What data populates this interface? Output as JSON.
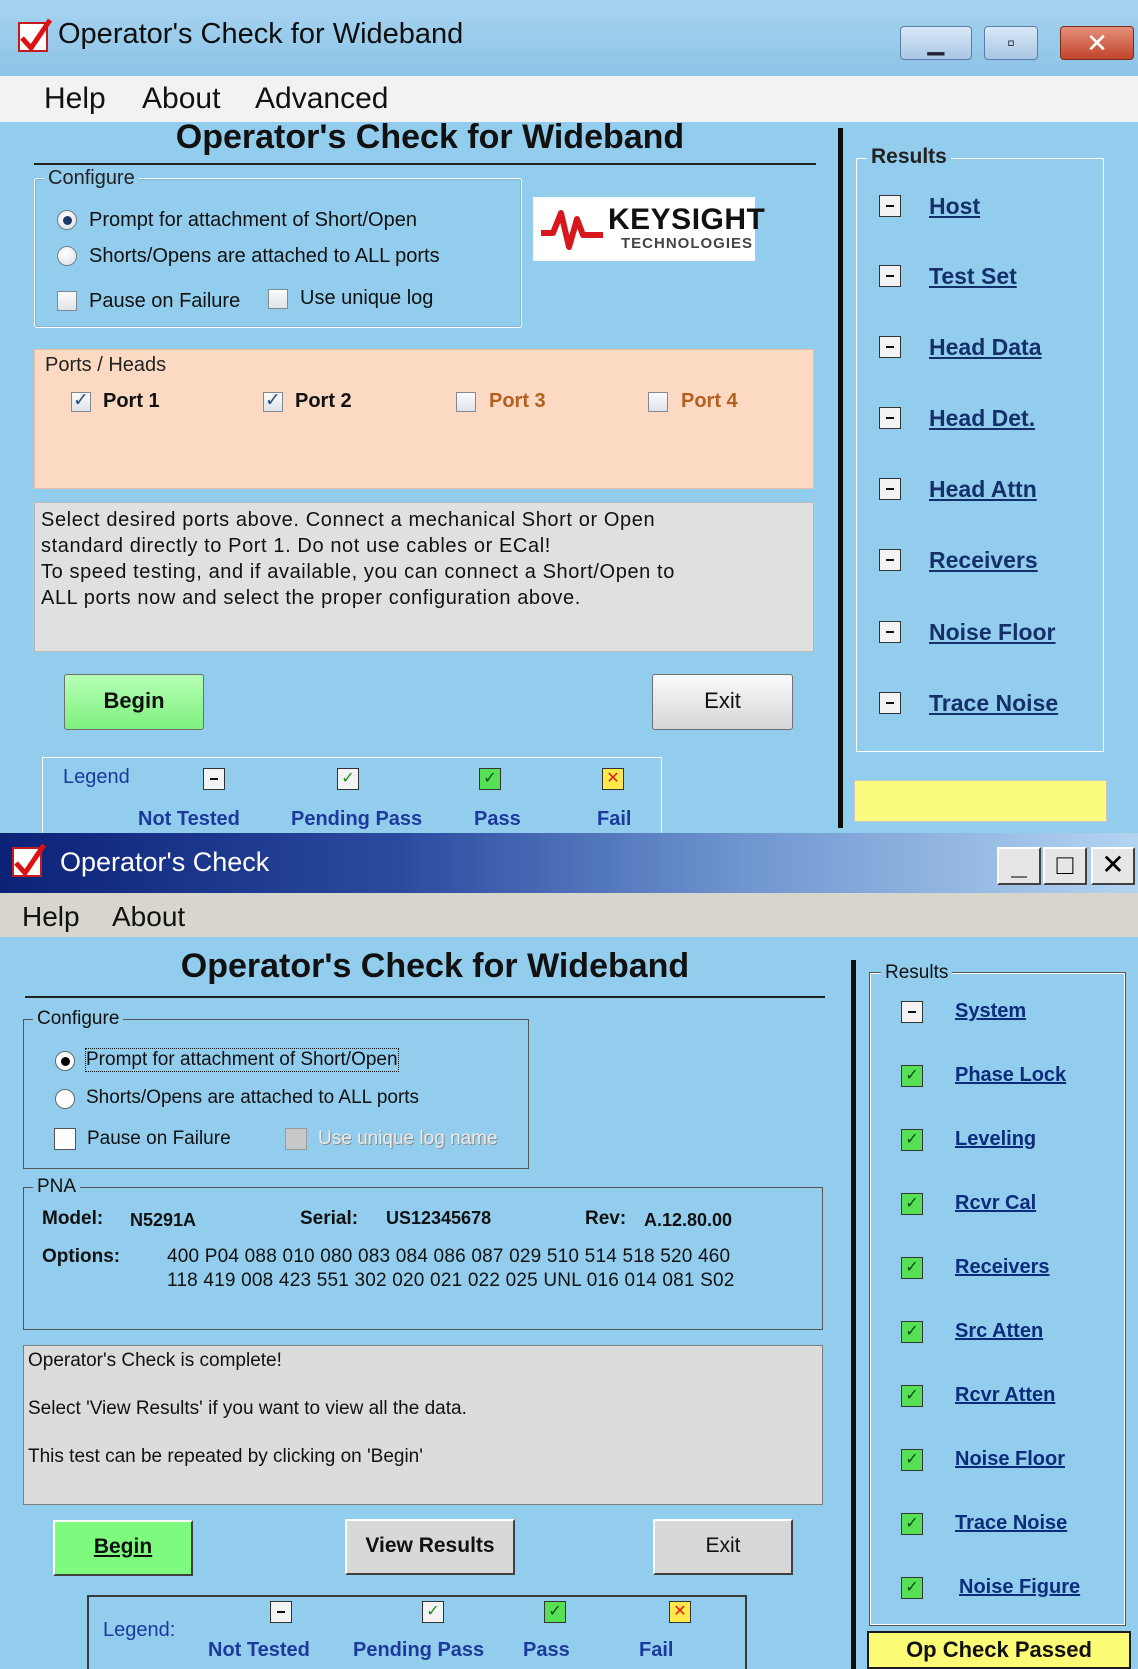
{
  "window1": {
    "title": "Operator's Check for Wideband",
    "menu": [
      "Help",
      "About",
      "Advanced"
    ],
    "heading": "Operator's Check for Wideband",
    "configure": {
      "label": "Configure",
      "radio_prompt": "Prompt for attachment of Short/Open",
      "radio_all": "Shorts/Opens are attached to ALL ports",
      "pause_on_failure": "Pause on Failure",
      "use_unique_log": "Use unique log"
    },
    "logo": {
      "name": "KEYSIGHT",
      "sub": "TECHNOLOGIES"
    },
    "ports": {
      "label": "Ports / Heads",
      "items": [
        {
          "label": "Port 1",
          "checked": true,
          "color": "#111111"
        },
        {
          "label": "Port 2",
          "checked": true,
          "color": "#111111"
        },
        {
          "label": "Port 3",
          "checked": false,
          "color": "#b4601e"
        },
        {
          "label": "Port 4",
          "checked": false,
          "color": "#b4601e"
        }
      ]
    },
    "message": [
      "Select desired ports above. Connect a mechanical Short or Open",
      "standard directly to Port 1. Do not use cables or ECal!",
      "To speed testing, and if available, you can connect a Short/Open to",
      "ALL ports now and select the proper configuration above."
    ],
    "begin": "Begin",
    "exit": "Exit",
    "legend": {
      "label": "Legend",
      "items": [
        "Not Tested",
        "Pending Pass",
        "Pass",
        "Fail"
      ]
    },
    "results": {
      "label": "Results",
      "items": [
        "Host",
        "Test Set",
        "Head Data",
        "Head Det.",
        "Head Attn",
        "Receivers",
        "Noise Floor",
        "Trace Noise"
      ]
    },
    "status": ""
  },
  "window2": {
    "title": "Operator's Check",
    "menu": [
      "Help",
      "About"
    ],
    "heading": "Operator's Check for Wideband",
    "configure": {
      "label": "Configure",
      "radio_prompt": "Prompt for attachment of Short/Open",
      "radio_all": "Shorts/Opens are attached to ALL ports",
      "pause_on_failure": "Pause on Failure",
      "use_unique_log": "Use unique log name"
    },
    "pna": {
      "label": "PNA",
      "model_label": "Model:",
      "model": "N5291A",
      "serial_label": "Serial:",
      "serial": "US12345678",
      "rev_label": "Rev:",
      "rev": "A.12.80.00",
      "options_label": "Options:",
      "options_line1": "400 P04 088 010 080 083 084 086 087 029 510 514 518 520 460",
      "options_line2": "118 419 008 423 551 302 020 021 022 025 UNL 016 014 081 S02"
    },
    "message": [
      "Operator's Check is complete!",
      "Select 'View Results' if you want to view all the data.",
      "This test can be repeated by clicking on 'Begin'"
    ],
    "begin": "Begin",
    "view_results": "View Results",
    "exit": "Exit",
    "legend": {
      "label": "Legend:",
      "items": [
        "Not Tested",
        "Pending Pass",
        "Pass",
        "Fail"
      ]
    },
    "results": {
      "label": "Results",
      "items": [
        {
          "label": "System",
          "state": "not-tested"
        },
        {
          "label": "Phase Lock",
          "state": "pass"
        },
        {
          "label": "Leveling",
          "state": "pass"
        },
        {
          "label": "Rcvr Cal",
          "state": "pass"
        },
        {
          "label": "Receivers",
          "state": "pass"
        },
        {
          "label": "Src Atten",
          "state": "pass"
        },
        {
          "label": "Rcvr Atten",
          "state": "pass"
        },
        {
          "label": "Noise Floor",
          "state": "pass"
        },
        {
          "label": "Trace Noise",
          "state": "pass"
        },
        {
          "label": "Noise Figure",
          "state": "pass"
        }
      ]
    },
    "status": "Op Check Passed"
  }
}
